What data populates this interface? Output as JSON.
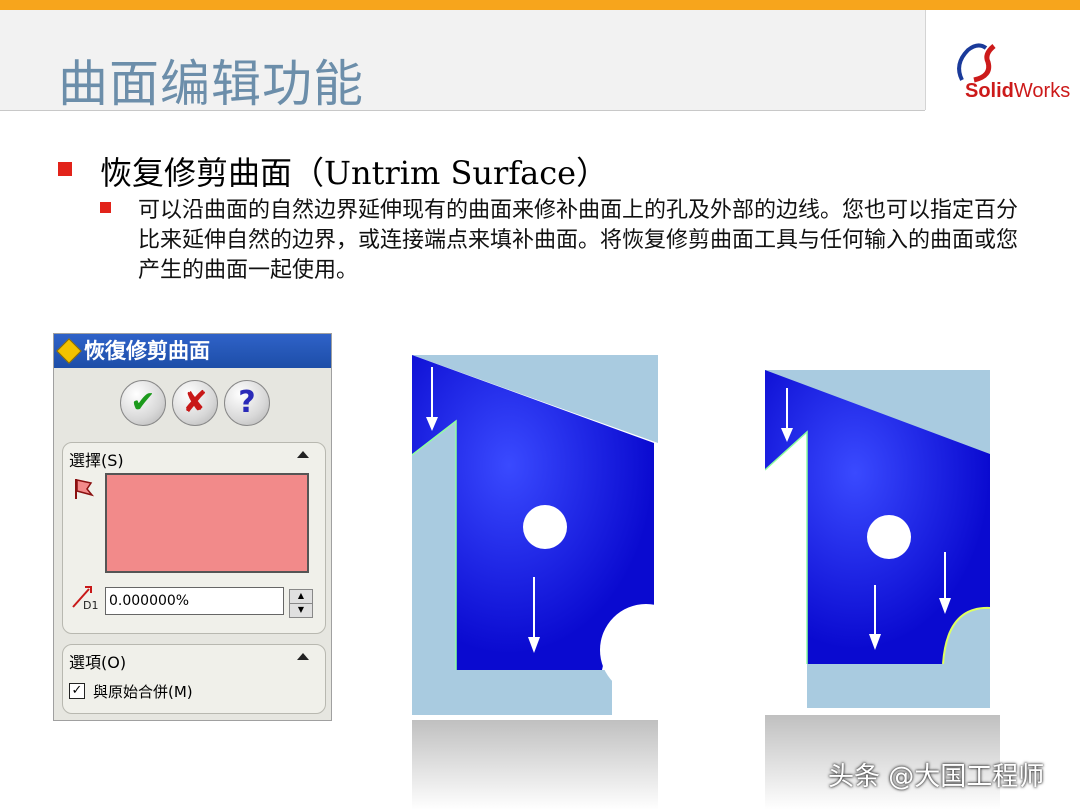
{
  "slide": {
    "title": "曲面编辑功能",
    "logo": {
      "ds": "DS",
      "brand_bold": "Solid",
      "brand_regular": "Works"
    },
    "heading": "恢复修剪曲面（Untrim Surface）",
    "description": "可以沿曲面的自然边界延伸现有的曲面来修补曲面上的孔及外部的边线。您也可以指定百分比来延伸自然的边界，或连接端点来填补曲面。将恢复修剪曲面工具与任何输入的曲面或您产生的曲面一起使用。",
    "watermark": "头条 @大国工程师"
  },
  "property_manager": {
    "title": "恢復修剪曲面",
    "buttons": {
      "ok": "✔",
      "cancel": "✘",
      "help": "?"
    },
    "selection_group": {
      "title": "選擇(S)",
      "distance_value": "0.000000%",
      "distance_icon_label": "D1"
    },
    "options_group": {
      "title": "選項(O)",
      "merge_label": "與原始合併(M)",
      "merge_checked": true
    }
  },
  "colors": {
    "accent_orange": "#f7a51c",
    "bullet_red": "#e2231a",
    "title_blue": "#6c8eaa",
    "surface_blue": "#1a1acc",
    "selection_pink": "#f28a8a"
  }
}
